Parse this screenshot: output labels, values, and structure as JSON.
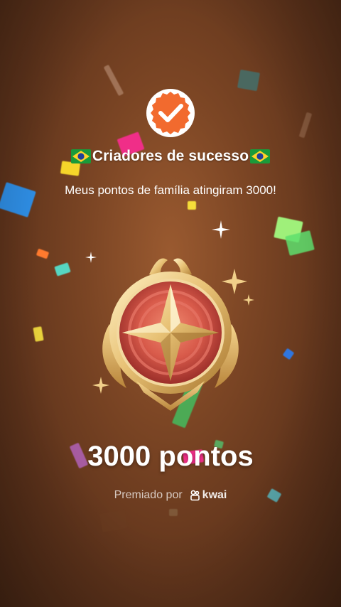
{
  "header": {
    "check_icon": "orange-badge-check-icon",
    "title": "Criadores de sucesso",
    "flag_left": "brazil-flag-icon",
    "flag_right": "brazil-flag-icon",
    "subtitle": "Meus pontos de família atingiram 3000!"
  },
  "reward": {
    "medal_icon": "gold-star-medal-icon",
    "points_label": "3000 pontos"
  },
  "footer": {
    "awarded_by_label": "Premiado por",
    "brand_icon": "kwai-logo-icon",
    "brand_name": "kwai"
  },
  "colors": {
    "background": "#7b4524",
    "badge_orange": "#f26a2e",
    "gold": "#e8c276"
  }
}
